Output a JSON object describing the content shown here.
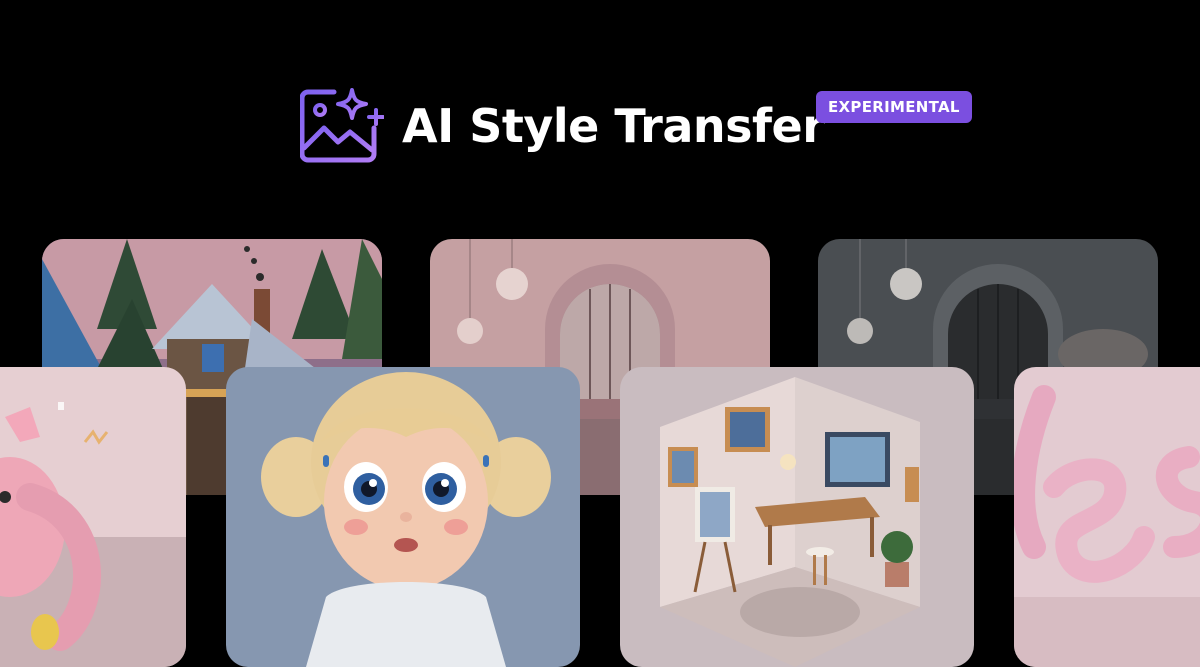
{
  "header": {
    "title": "AI Style Transfer",
    "badge": "EXPERIMENTAL",
    "logo_icon": "image-sparkle-icon",
    "accent_color": "#7b4fe0"
  },
  "gallery": {
    "cards": [
      {
        "name": "cabin-forest-image"
      },
      {
        "name": "pink-arch-room-image"
      },
      {
        "name": "dark-arch-room-image"
      },
      {
        "name": "pink-bunny-image"
      },
      {
        "name": "cartoon-girl-image"
      },
      {
        "name": "isometric-room-image"
      },
      {
        "name": "balloon-lettering-image"
      }
    ]
  }
}
